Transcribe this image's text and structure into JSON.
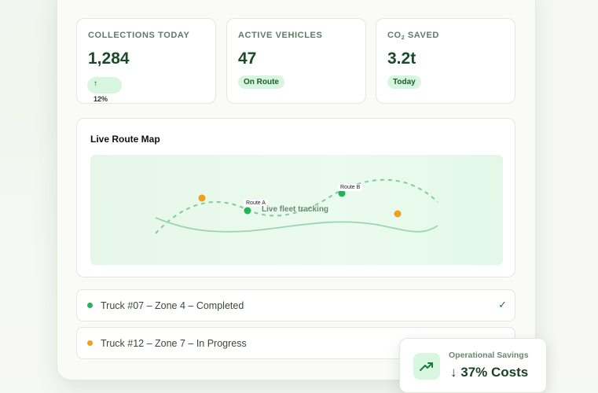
{
  "stats": [
    {
      "label": "COLLECTIONS TODAY",
      "value": "1,284",
      "trend_arrow": "↑",
      "trend_value": "12%"
    },
    {
      "label": "ACTIVE VEHICLES",
      "value": "47",
      "badge": "On Route"
    },
    {
      "label_prefix": "CO",
      "label_sub": "2",
      "label_suffix": " SAVED",
      "value": "3.2t",
      "badge": "Today"
    }
  ],
  "map": {
    "title": "Live Route Map",
    "caption": "Live fleet tracking",
    "route_a": "Route A",
    "route_b": "Route B"
  },
  "trucks": [
    {
      "text": "Truck #07 – Zone 4 – Completed",
      "status": "completed",
      "status_icon": "✓",
      "color": "#22b455"
    },
    {
      "text": "Truck #12 – Zone 7 – In Progress",
      "status": "in-progress",
      "color": "#f0a01f"
    }
  ],
  "savings": {
    "label": "Operational Savings",
    "value": "↓ 37% Costs",
    "icon": "trending-up-icon"
  },
  "colors": {
    "accent_green": "#22b455",
    "accent_orange": "#f0a01f",
    "pill_bg": "#d8f5df"
  }
}
